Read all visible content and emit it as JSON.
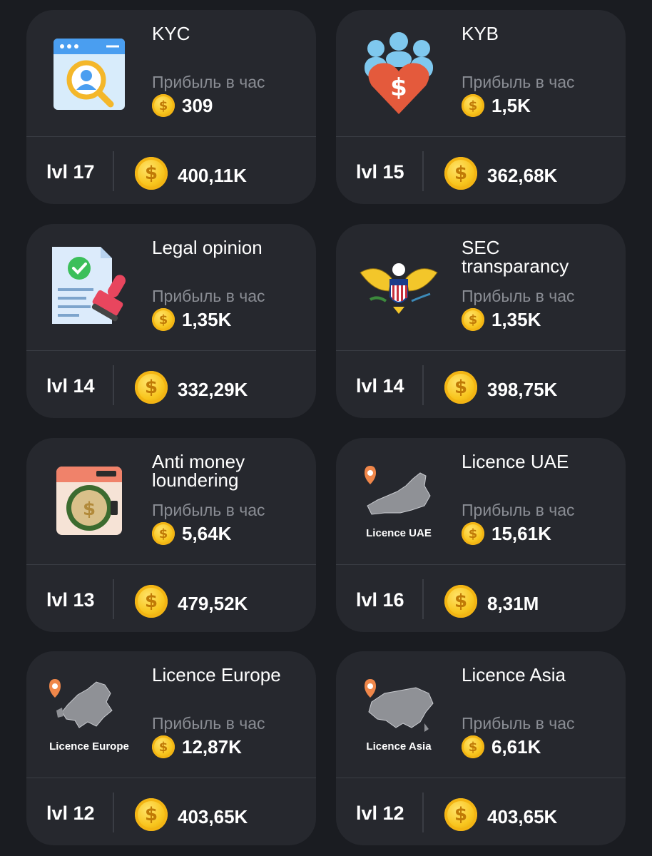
{
  "profit_label": "Прибыль в час",
  "cards": [
    {
      "title": "KYC",
      "profit": "309",
      "level": "lvl 17",
      "cost": "400,11K",
      "icon": "kyc-search-icon"
    },
    {
      "title": "KYB",
      "profit": "1,5K",
      "level": "lvl 15",
      "cost": "362,68K",
      "icon": "kyb-heart-icon"
    },
    {
      "title": "Legal opinion",
      "profit": "1,35K",
      "level": "lvl 14",
      "cost": "332,29K",
      "icon": "legal-document-stamp-icon"
    },
    {
      "title": "SEC transparancy",
      "profit": "1,35K",
      "level": "lvl 14",
      "cost": "398,75K",
      "icon": "eagle-seal-icon"
    },
    {
      "title": "Anti money loundering",
      "profit": "5,64K",
      "level": "lvl 13",
      "cost": "479,52K",
      "icon": "washing-machine-icon"
    },
    {
      "title": "Licence UAE",
      "profit": "15,61K",
      "level": "lvl 16",
      "cost": "8,31M",
      "icon": "uae-map-icon",
      "map_caption": "Licence UAE"
    },
    {
      "title": "Licence Europe",
      "profit": "12,87K",
      "level": "lvl 12",
      "cost": "403,65K",
      "icon": "europe-map-icon",
      "map_caption": "Licence Europe"
    },
    {
      "title": "Licence Asia",
      "profit": "6,61K",
      "level": "lvl 12",
      "cost": "403,65K",
      "icon": "asia-map-icon",
      "map_caption": "Licence Asia"
    }
  ],
  "coin_symbol": "$",
  "colors": {
    "background": "#1a1c21",
    "card": "#26282e",
    "muted_text": "#8a8d94",
    "coin": "#f8c51d"
  }
}
